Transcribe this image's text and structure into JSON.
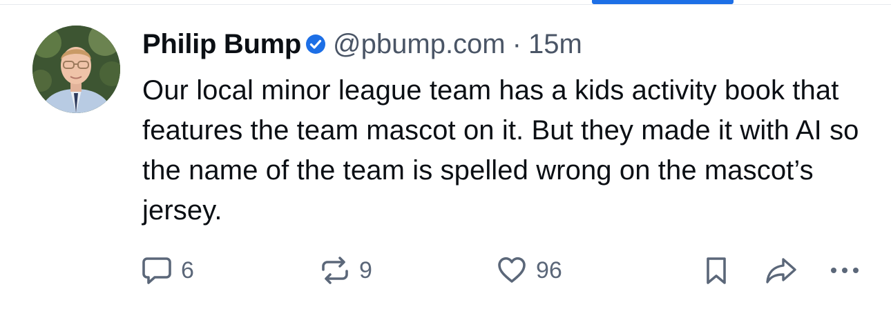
{
  "colors": {
    "accent": "#1d6fe6",
    "text": "#0b0f14",
    "muted": "#5b6779",
    "divider": "#e6e9ee"
  },
  "post": {
    "author": {
      "display_name": "Philip Bump",
      "handle": "@pbump.com",
      "verified_icon": "verified-check-icon"
    },
    "separator": "·",
    "time": "15m",
    "text": "Our local minor league team has a kids activity book that features the team mascot on it. But they made it with AI so the name of the team is spelled wrong on the mascot’s jersey."
  },
  "actions": {
    "reply": {
      "icon": "reply-bubble-icon",
      "count": "6"
    },
    "repost": {
      "icon": "repost-icon",
      "count": "9"
    },
    "like": {
      "icon": "heart-icon",
      "count": "96"
    },
    "bookmark": {
      "icon": "bookmark-icon"
    },
    "share": {
      "icon": "share-arrow-icon"
    },
    "more": {
      "icon": "more-dots-icon"
    }
  }
}
